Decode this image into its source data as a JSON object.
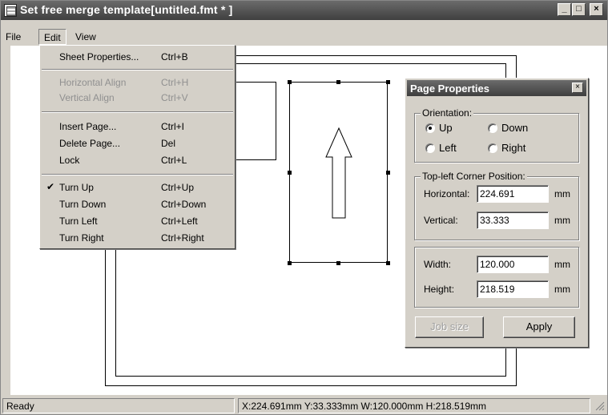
{
  "window": {
    "title": "Set free merge template[untitled.fmt * ]",
    "minimize_glyph": "_",
    "maximize_glyph": "□",
    "close_glyph": "×"
  },
  "menubar": {
    "file": "File",
    "edit": "Edit",
    "view": "View"
  },
  "edit_menu": {
    "items": [
      {
        "label": "Sheet Properties...",
        "accel": "Ctrl+B",
        "enabled": true,
        "checked": false
      },
      {
        "label": "Horizontal Align",
        "accel": "Ctrl+H",
        "enabled": false,
        "checked": false
      },
      {
        "label": "Vertical Align",
        "accel": "Ctrl+V",
        "enabled": false,
        "checked": false
      },
      {
        "label": "Insert Page...",
        "accel": "Ctrl+I",
        "enabled": true,
        "checked": false
      },
      {
        "label": "Delete Page...",
        "accel": "Del",
        "enabled": true,
        "checked": false
      },
      {
        "label": "Lock",
        "accel": "Ctrl+L",
        "enabled": true,
        "checked": false
      },
      {
        "label": "Turn Up",
        "accel": "Ctrl+Up",
        "enabled": true,
        "checked": true
      },
      {
        "label": "Turn Down",
        "accel": "Ctrl+Down",
        "enabled": true,
        "checked": false
      },
      {
        "label": "Turn Left",
        "accel": "Ctrl+Left",
        "enabled": true,
        "checked": false
      },
      {
        "label": "Turn Right",
        "accel": "Ctrl+Right",
        "enabled": true,
        "checked": false
      }
    ],
    "check_glyph": "✔"
  },
  "page_properties": {
    "title": "Page Properties",
    "close_glyph": "×",
    "orientation": {
      "legend": "Orientation:",
      "up": "Up",
      "down": "Down",
      "left": "Left",
      "right": "Right",
      "selected": "Up"
    },
    "position": {
      "legend": "Top-left Corner Position:",
      "horizontal_label": "Horizontal:",
      "horizontal_value": "224.691",
      "vertical_label": "Vertical:",
      "vertical_value": "33.333",
      "unit": "mm"
    },
    "size": {
      "width_label": "Width:",
      "width_value": "120.000",
      "height_label": "Height:",
      "height_value": "218.519",
      "unit": "mm"
    },
    "job_size_label": "Job size",
    "apply_label": "Apply"
  },
  "statusbar": {
    "status": "Ready",
    "coords": "X:224.691mm Y:33.333mm W:120.000mm H:218.519mm"
  }
}
